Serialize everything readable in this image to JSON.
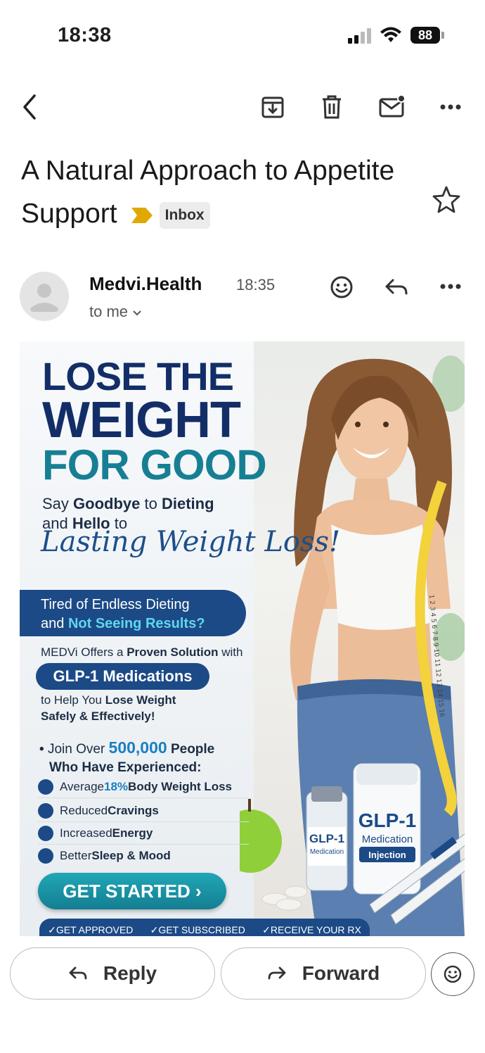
{
  "status_bar": {
    "time": "18:38",
    "battery": "88"
  },
  "email": {
    "subject": "A Natural Approach to Appetite Support",
    "label": "Inbox",
    "sender": "Medvi.Health",
    "time": "18:35",
    "recipient": "to me"
  },
  "banner": {
    "headline_1": "LOSE THE",
    "headline_2": "WEIGHT",
    "headline_3": "FOR GOOD",
    "tagline_1a": "Say ",
    "tagline_1b": "Goodbye",
    "tagline_1c": " to ",
    "tagline_1d": "Dieting",
    "tagline_2a": "and ",
    "tagline_2b": "Hello",
    "tagline_2c": " to",
    "script": "Lasting Weight Loss!",
    "pill_line_1": "Tired of Endless Dieting",
    "pill_line_2a": "and ",
    "pill_line_2b": "Not Seeing Results?",
    "offer_a": "MEDVi Offers a ",
    "offer_b": "Proven Solution",
    "offer_c": " with",
    "glp": "GLP-1 Medications",
    "help_1a": "to Help You ",
    "help_1b": "Lose Weight",
    "help_2": "Safely & Effectively!",
    "join_a": "Join Over ",
    "join_num": "500,000",
    "join_b": " People",
    "join_2": "Who Have Experienced:",
    "benefits": [
      {
        "a": "Average ",
        "b": "18%",
        "c": " Body Weight Loss"
      },
      {
        "a": "Reduced ",
        "b": "Cravings",
        "c": ""
      },
      {
        "a": "Increased ",
        "b": "Energy",
        "c": ""
      },
      {
        "a": "Better ",
        "b": "Sleep & Mood",
        "c": ""
      }
    ],
    "cta": "GET STARTED ›",
    "steps": [
      "✓GET APPROVED",
      "✓GET SUBSCRIBED",
      "✓RECEIVE YOUR RX"
    ],
    "vial_label": "GLP-1",
    "vial_sub": "Medication",
    "jar_label": "GLP-1",
    "jar_sub": "Medication",
    "jar_tag": "Injection",
    "tape_marks": "1 2 3 4 5 6 7 8 9 10 11 12 13 14 15 16"
  },
  "actions": {
    "reply": "Reply",
    "forward": "Forward"
  },
  "colors": {
    "navy": "#1c4a86",
    "teal": "#1a8a9a",
    "label_marker": "#e0a800"
  }
}
